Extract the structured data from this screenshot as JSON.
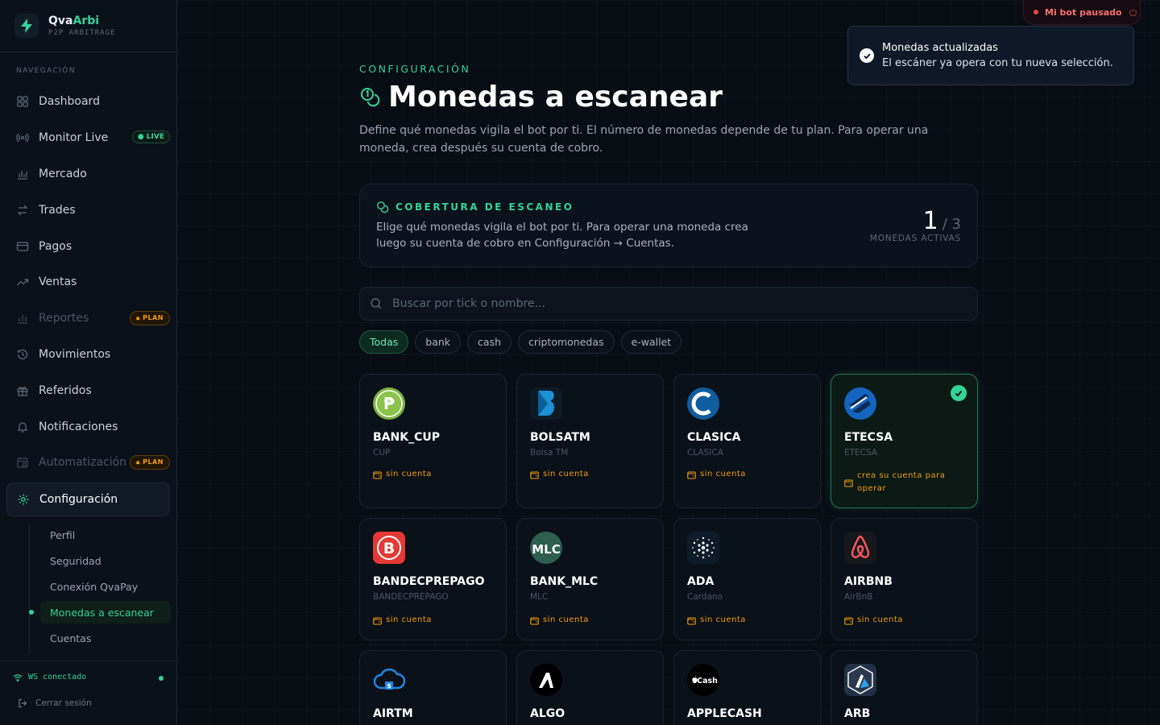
{
  "brand": {
    "name_a": "Qva",
    "name_b": "Arbi",
    "subtitle": "P2P ARBITRAGE"
  },
  "nav": {
    "section_label": "NAVEGACIÓN",
    "items": [
      {
        "label": "Dashboard",
        "icon": "dashboard-icon"
      },
      {
        "label": "Monitor Live",
        "icon": "broadcast-icon",
        "badge": "● LIVE"
      },
      {
        "label": "Mercado",
        "icon": "bar-chart-icon"
      },
      {
        "label": "Trades",
        "icon": "arrows-swap-icon"
      },
      {
        "label": "Pagos",
        "icon": "credit-card-icon"
      },
      {
        "label": "Ventas",
        "icon": "trending-up-icon"
      },
      {
        "label": "Reportes",
        "icon": "reports-icon",
        "badge": "PLAN",
        "disabled": true
      },
      {
        "label": "Movimientos",
        "icon": "history-icon"
      },
      {
        "label": "Referidos",
        "icon": "gift-icon"
      },
      {
        "label": "Notificaciones",
        "icon": "bell-icon"
      },
      {
        "label": "Automatización",
        "icon": "calendar-icon",
        "badge": "PLAN",
        "disabled": true
      },
      {
        "label": "Configuración",
        "icon": "gear-icon",
        "active": true
      }
    ],
    "sub_items": [
      "Perfil",
      "Seguridad",
      "Conexión QvaPay",
      "Monedas a escanear",
      "Cuentas"
    ],
    "ws_status": "WS conectado",
    "logout": "Cerrar sesión"
  },
  "header": {
    "bot_status": "Mi bot pausado",
    "toast_title": "Monedas actualizadas",
    "toast_message": "El escáner ya opera con tu nueva selección."
  },
  "page": {
    "eyebrow": "CONFIGURACIÓN",
    "title": "Monedas a escanear",
    "description": "Define qué monedas vigila el bot por ti. El número de monedas depende de tu plan. Para operar una moneda, crea después su cuenta de cobro."
  },
  "coverage": {
    "label": "COBERTURA DE ESCANEO",
    "description": "Elige qué monedas vigila el bot por ti. Para operar una moneda crea luego su cuenta de cobro en Configuración → Cuentas.",
    "active": "1",
    "total": "/ 3",
    "sub": "MONEDAS ACTIVAS"
  },
  "search": {
    "placeholder": "Buscar por tick o nombre..."
  },
  "filters": [
    "Todas",
    "bank",
    "cash",
    "criptomonedas",
    "e-wallet"
  ],
  "coins": [
    {
      "tick": "BANK_CUP",
      "name": "CUP",
      "status": "sin cuenta",
      "color": "#7cb342"
    },
    {
      "tick": "BOLSATM",
      "name": "Bolsa TM",
      "status": "sin cuenta",
      "color": "#1e88c9"
    },
    {
      "tick": "CLASICA",
      "name": "CLASICA",
      "status": "sin cuenta",
      "color": "#0f5c9e"
    },
    {
      "tick": "ETECSA",
      "name": "ETECSA",
      "status": "crea su cuenta para operar",
      "color": "#1565c0"
    },
    {
      "tick": "BANDECPREPAGO",
      "name": "BANDECPREPAGO",
      "status": "sin cuenta",
      "color": "#e53935"
    },
    {
      "tick": "BANK_MLC",
      "name": "MLC",
      "status": "sin cuenta",
      "color": "#2e5e4e"
    },
    {
      "tick": "ADA",
      "name": "Cardano",
      "status": "sin cuenta",
      "color": "#0d1b2a"
    },
    {
      "tick": "AIRBNB",
      "name": "AirBnB",
      "status": "sin cuenta",
      "color": "#ff5a5f"
    },
    {
      "tick": "AIRTM",
      "name": "",
      "status": "",
      "color": "#1e88e5"
    },
    {
      "tick": "ALGO",
      "name": "",
      "status": "",
      "color": "#000000"
    },
    {
      "tick": "APPLECASH",
      "name": "",
      "status": "",
      "color": "#000000",
      "logo_text": "Cash"
    },
    {
      "tick": "ARB",
      "name": "",
      "status": "",
      "color": "#213147"
    }
  ]
}
